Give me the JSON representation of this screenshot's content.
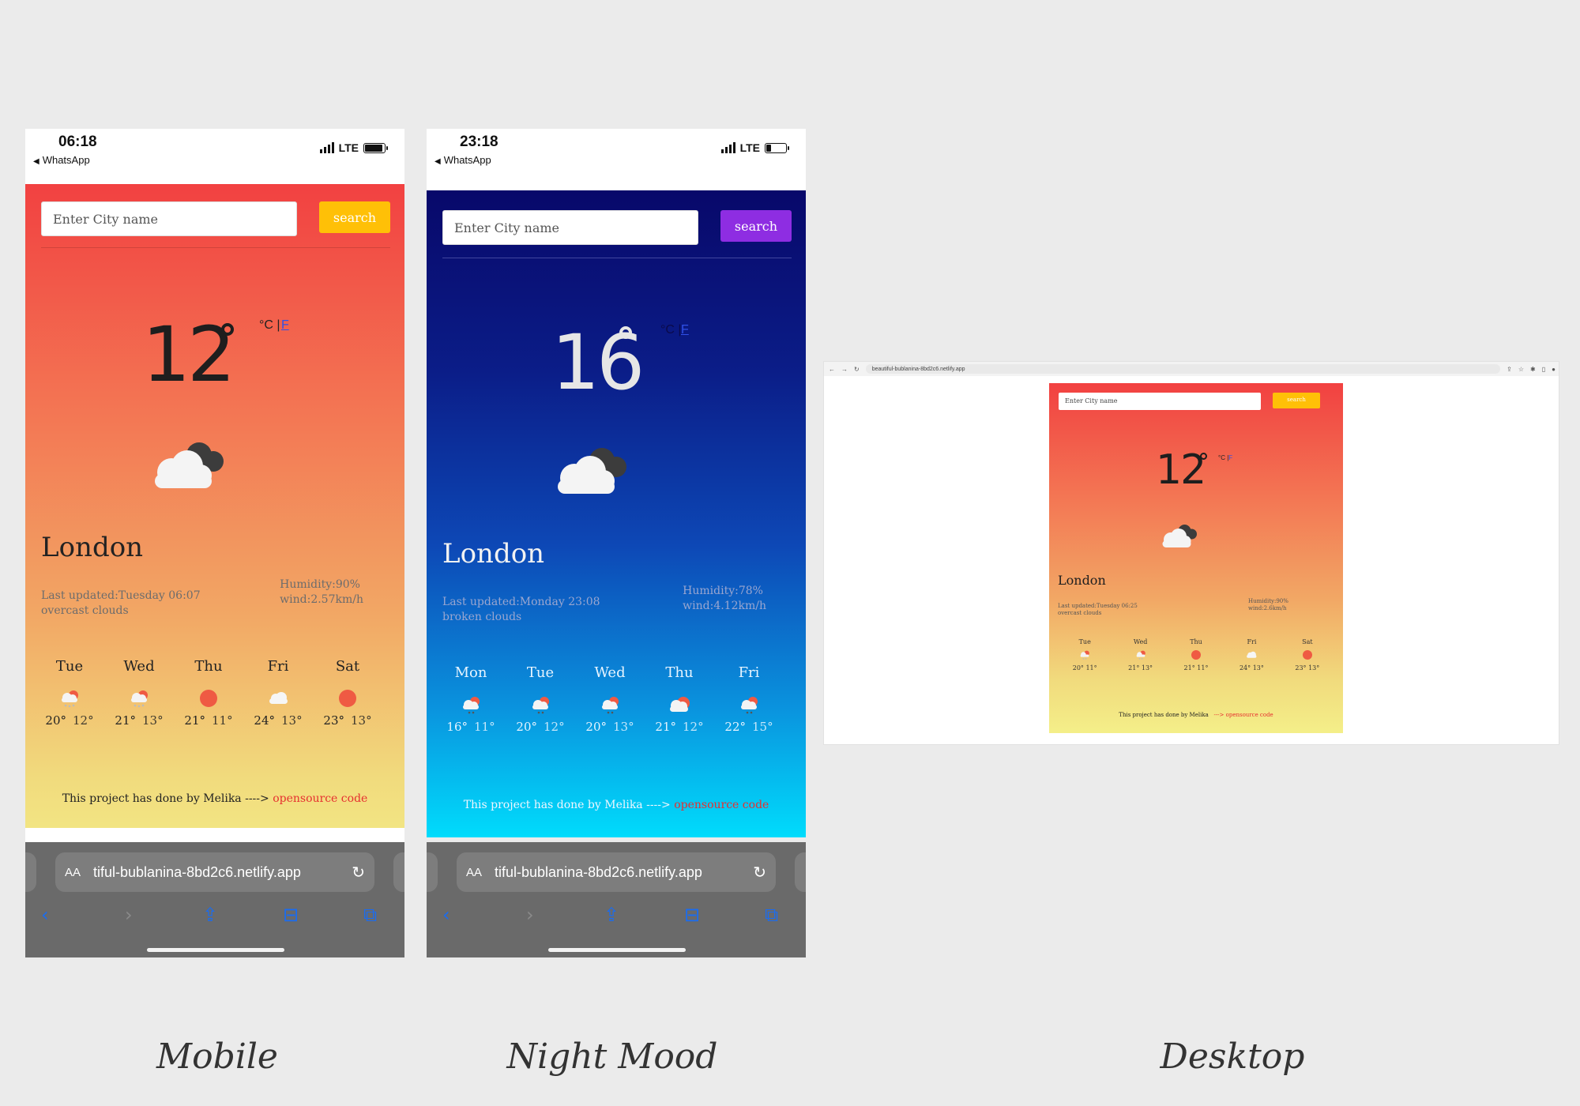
{
  "mobile": {
    "status": {
      "time": "06:18",
      "back_label": "WhatsApp",
      "network": "LTE",
      "battery_level": 0.9
    },
    "search": {
      "placeholder": "Enter City name",
      "button_label": "search",
      "button_color": "#ffc007"
    },
    "temperature": "12",
    "unit_c": "°C |",
    "unit_f": "F",
    "condition_icon": "cloud-icon",
    "city": "London",
    "last_updated": "Last updated:Tuesday 06:07",
    "description": "overcast clouds",
    "humidity": "Humidity:90%",
    "wind": "wind:2.57km/h",
    "forecast": [
      {
        "day": "Tue",
        "icon": "rain-cloud-icon",
        "max": "20°",
        "min": "12°"
      },
      {
        "day": "Wed",
        "icon": "rain-cloud-icon",
        "max": "21°",
        "min": "13°"
      },
      {
        "day": "Thu",
        "icon": "sun-icon",
        "max": "21°",
        "min": "11°"
      },
      {
        "day": "Fri",
        "icon": "cloud-icon",
        "max": "24°",
        "min": "13°"
      },
      {
        "day": "Sat",
        "icon": "sun-icon",
        "max": "23°",
        "min": "13°"
      }
    ],
    "footer_text": "This project has done by Melika ---->",
    "footer_link": "opensource code",
    "url": "tiful-bublanina-8bd2c6.netlify.app",
    "url_aa": "AA"
  },
  "night": {
    "status": {
      "time": "23:18",
      "back_label": "WhatsApp",
      "network": "LTE",
      "battery_level": 0.25
    },
    "search": {
      "placeholder": "Enter City name",
      "button_label": "search",
      "button_color": "#8e2de2"
    },
    "temperature": "16",
    "unit_c": "°C |",
    "unit_f": "F",
    "condition_icon": "cloud-icon",
    "city": "London",
    "last_updated": "Last updated:Monday 23:08",
    "description": "broken clouds",
    "humidity": "Humidity:78%",
    "wind": "wind:4.12km/h",
    "forecast": [
      {
        "day": "Mon",
        "icon": "sun-cloud-icon",
        "max": "16°",
        "min": "11°"
      },
      {
        "day": "Tue",
        "icon": "sun-cloud-icon",
        "max": "20°",
        "min": "12°"
      },
      {
        "day": "Wed",
        "icon": "sun-cloud-icon",
        "max": "20°",
        "min": "13°"
      },
      {
        "day": "Thu",
        "icon": "sun-cloud-icon",
        "max": "21°",
        "min": "12°"
      },
      {
        "day": "Fri",
        "icon": "sun-cloud-icon",
        "max": "22°",
        "min": "15°"
      }
    ],
    "footer_text": "This project has done by Melika ---->",
    "footer_link": "opensource code",
    "url": "tiful-bublanina-8bd2c6.netlify.app",
    "url_aa": "AA"
  },
  "desktop": {
    "address": "beautiful-bublanina-8bd2c6.netlify.app",
    "search": {
      "placeholder": "Enter City name",
      "button_label": "search"
    },
    "temperature": "12",
    "unit_c": "°C |",
    "unit_f": "F",
    "city": "London",
    "last_updated": "Last updated:Tuesday 06:25",
    "description": "overcast clouds",
    "humidity": "Humidity:90%",
    "wind": "wind:2.6km/h",
    "forecast": [
      {
        "day": "Tue",
        "icon": "rain-cloud-icon",
        "max": "20°",
        "min": "11°"
      },
      {
        "day": "Wed",
        "icon": "rain-cloud-icon",
        "max": "21°",
        "min": "13°"
      },
      {
        "day": "Thu",
        "icon": "sun-icon",
        "max": "21°",
        "min": "11°"
      },
      {
        "day": "Fri",
        "icon": "cloud-icon",
        "max": "24°",
        "min": "13°"
      },
      {
        "day": "Sat",
        "icon": "sun-icon",
        "max": "23°",
        "min": "13°"
      }
    ],
    "footer_text": "This project has done by Melika",
    "footer_link": "---> opensource code"
  },
  "captions": {
    "mobile": "Mobile",
    "night": "Night Mood",
    "desktop": "Desktop"
  },
  "colors": {
    "sun": "#ef5a43",
    "accent_red": "#e63030",
    "link_blue": "#3050e8"
  }
}
